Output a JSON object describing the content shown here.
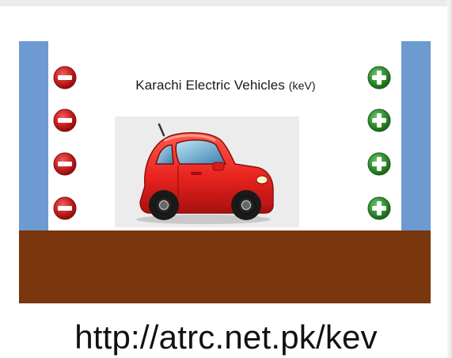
{
  "banner": {
    "title_main": "Karachi Electric Vehicles",
    "title_unit": "(keV)",
    "url": "http://atrc.net.pk/kev"
  },
  "charges": {
    "left": [
      "negative",
      "negative",
      "negative",
      "negative"
    ],
    "right": [
      "positive",
      "positive",
      "positive",
      "positive"
    ]
  },
  "icons": {
    "negative": "minus-circle-icon",
    "positive": "plus-circle-icon",
    "vehicle": "red-car-icon"
  },
  "colors": {
    "wall": "#6d9ad1",
    "ground": "#7a360c",
    "negative": "#c21c1c",
    "positive": "#2e8a2e",
    "car": "#e8231f"
  }
}
